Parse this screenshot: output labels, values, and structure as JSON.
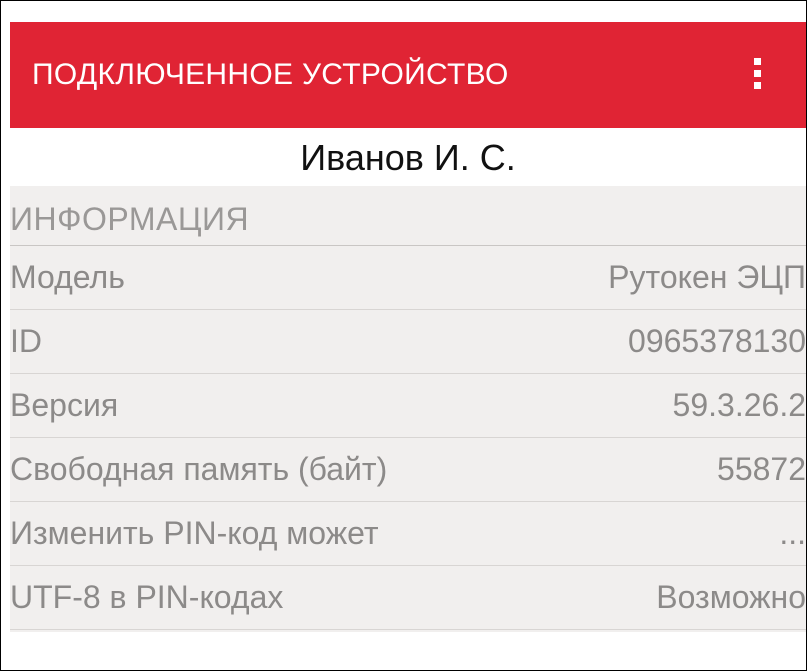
{
  "appbar": {
    "title": "ПОДКЛЮЧЕННОЕ УСТРОЙСТВО",
    "menu_icon": "more-vertical-icon",
    "color": "#e02434"
  },
  "owner": {
    "name": "Иванов И. С."
  },
  "info": {
    "section_title": "ИНФОРМАЦИЯ",
    "rows": [
      {
        "label": "Модель",
        "value": "Рутокен ЭЦП"
      },
      {
        "label": "ID",
        "value": "0965378130"
      },
      {
        "label": "Версия",
        "value": "59.3.26.2"
      },
      {
        "label": "Свободная память (байт)",
        "value": "55872"
      },
      {
        "label": "Изменить PIN-код может",
        "value": "..."
      },
      {
        "label": "UTF-8 в PIN-кодах",
        "value": "Возможно"
      }
    ]
  }
}
